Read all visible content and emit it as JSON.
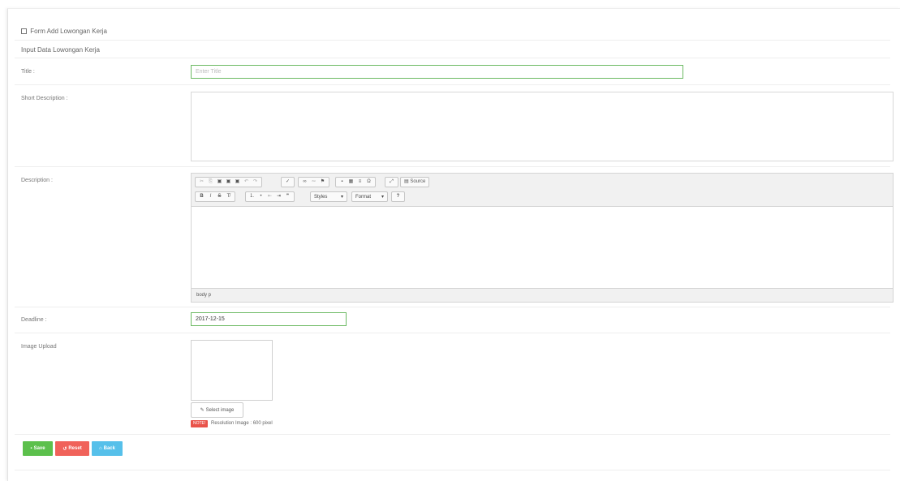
{
  "panel": {
    "title": "Form Add Lowongan Kerja",
    "title_icon": "form-icon",
    "subtitle": "Input Data Lowongan Kerja"
  },
  "fields": {
    "title_label": "Title :",
    "title_placeholder": "Enter Title",
    "short_desc_label": "Short Description :",
    "description_label": "Description :",
    "deadline_label": "Deadline :",
    "deadline_value": "2017-12-15",
    "image_label": "Image Upload"
  },
  "editor": {
    "source_label": "Source",
    "styles_label": "Styles",
    "format_label": "Format",
    "footer_path": "body p",
    "help_label": "?"
  },
  "image_upload": {
    "select_label": "Select image",
    "note_badge": "NOTE!",
    "note_text": "Resolution Image : 600 pixel"
  },
  "actions": {
    "save_label": "Save",
    "reset_label": "Reset",
    "back_label": "Back"
  },
  "colors": {
    "save": "#5cc04c",
    "reset": "#f0625a",
    "back": "#56c0ea",
    "focus_border": "#6cba63",
    "note": "#e9534a"
  }
}
